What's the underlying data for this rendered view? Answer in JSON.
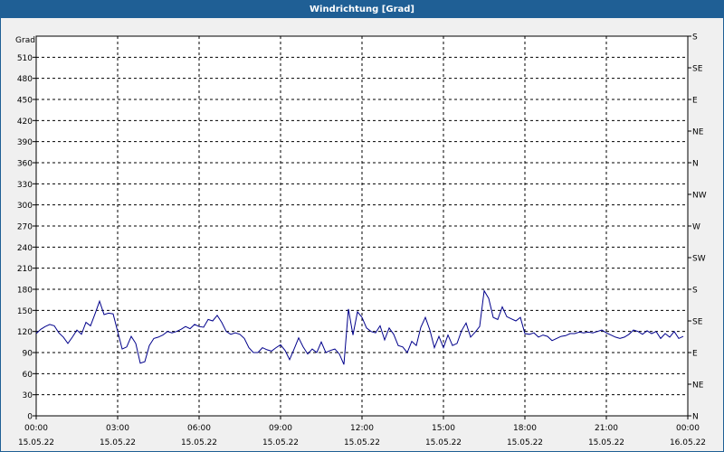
{
  "window": {
    "title": "Windrichtung [Grad]"
  },
  "chart_data": {
    "type": "line",
    "title": "Windrichtung [Grad]",
    "ylabel": "Grad",
    "ylim": [
      0,
      540
    ],
    "xlim": [
      "2022-05-15T00:00",
      "2022-05-16T00:00"
    ],
    "grid": true,
    "y_ticks": [
      0,
      30,
      60,
      90,
      120,
      150,
      180,
      210,
      240,
      270,
      300,
      330,
      360,
      390,
      420,
      450,
      480,
      510
    ],
    "y2_ticks": [
      {
        "value": 0,
        "label": "N"
      },
      {
        "value": 45,
        "label": "NE"
      },
      {
        "value": 90,
        "label": "E"
      },
      {
        "value": 135,
        "label": "SE"
      },
      {
        "value": 180,
        "label": "S"
      },
      {
        "value": 225,
        "label": "SW"
      },
      {
        "value": 270,
        "label": "W"
      },
      {
        "value": 315,
        "label": "NW"
      },
      {
        "value": 360,
        "label": "N"
      },
      {
        "value": 405,
        "label": "NE"
      },
      {
        "value": 450,
        "label": "E"
      },
      {
        "value": 495,
        "label": "SE"
      },
      {
        "value": 540,
        "label": "S"
      }
    ],
    "x_ticks": [
      {
        "time": "00:00",
        "date": "15.05.22"
      },
      {
        "time": "03:00",
        "date": "15.05.22"
      },
      {
        "time": "06:00",
        "date": "15.05.22"
      },
      {
        "time": "09:00",
        "date": "15.05.22"
      },
      {
        "time": "12:00",
        "date": "15.05.22"
      },
      {
        "time": "15:00",
        "date": "15.05.22"
      },
      {
        "time": "18:00",
        "date": "15.05.22"
      },
      {
        "time": "21:00",
        "date": "15.05.22"
      },
      {
        "time": "00:00",
        "date": "16.05.22"
      }
    ],
    "series": [
      {
        "color": "#00008b",
        "points": [
          [
            "00:00",
            117
          ],
          [
            "00:10",
            123
          ],
          [
            "00:20",
            127
          ],
          [
            "00:30",
            130
          ],
          [
            "00:40",
            128
          ],
          [
            "00:50",
            118
          ],
          [
            "01:00",
            112
          ],
          [
            "01:10",
            103
          ],
          [
            "01:20",
            112
          ],
          [
            "01:30",
            122
          ],
          [
            "01:40",
            116
          ],
          [
            "01:50",
            133
          ],
          [
            "02:00",
            128
          ],
          [
            "02:10",
            145
          ],
          [
            "02:20",
            163
          ],
          [
            "02:30",
            144
          ],
          [
            "02:40",
            146
          ],
          [
            "02:50",
            145
          ],
          [
            "03:00",
            120
          ],
          [
            "03:10",
            95
          ],
          [
            "03:20",
            98
          ],
          [
            "03:30",
            113
          ],
          [
            "03:40",
            103
          ],
          [
            "03:50",
            75
          ],
          [
            "04:00",
            77
          ],
          [
            "04:10",
            100
          ],
          [
            "04:20",
            110
          ],
          [
            "04:30",
            112
          ],
          [
            "04:40",
            115
          ],
          [
            "04:50",
            120
          ],
          [
            "05:00",
            118
          ],
          [
            "05:10",
            120
          ],
          [
            "05:20",
            123
          ],
          [
            "05:30",
            127
          ],
          [
            "05:40",
            124
          ],
          [
            "05:50",
            130
          ],
          [
            "06:00",
            127
          ],
          [
            "06:10",
            126
          ],
          [
            "06:20",
            137
          ],
          [
            "06:30",
            135
          ],
          [
            "06:40",
            143
          ],
          [
            "06:50",
            133
          ],
          [
            "07:00",
            120
          ],
          [
            "07:10",
            116
          ],
          [
            "07:20",
            118
          ],
          [
            "07:30",
            116
          ],
          [
            "07:40",
            110
          ],
          [
            "07:50",
            97
          ],
          [
            "08:00",
            90
          ],
          [
            "08:10",
            90
          ],
          [
            "08:20",
            97
          ],
          [
            "08:30",
            94
          ],
          [
            "08:40",
            92
          ],
          [
            "08:50",
            97
          ],
          [
            "09:00",
            101
          ],
          [
            "09:10",
            93
          ],
          [
            "09:20",
            80
          ],
          [
            "09:30",
            95
          ],
          [
            "09:40",
            111
          ],
          [
            "09:50",
            98
          ],
          [
            "10:00",
            88
          ],
          [
            "10:10",
            95
          ],
          [
            "10:20",
            90
          ],
          [
            "10:30",
            105
          ],
          [
            "10:40",
            90
          ],
          [
            "10:50",
            93
          ],
          [
            "11:00",
            95
          ],
          [
            "11:10",
            88
          ],
          [
            "11:20",
            73
          ],
          [
            "11:30",
            152
          ],
          [
            "11:40",
            115
          ],
          [
            "11:50",
            148
          ],
          [
            "12:00",
            140
          ],
          [
            "12:10",
            125
          ],
          [
            "12:20",
            120
          ],
          [
            "12:30",
            118
          ],
          [
            "12:40",
            128
          ],
          [
            "12:50",
            108
          ],
          [
            "13:00",
            125
          ],
          [
            "13:10",
            116
          ],
          [
            "13:20",
            100
          ],
          [
            "13:30",
            98
          ],
          [
            "13:40",
            90
          ],
          [
            "13:50",
            106
          ],
          [
            "14:00",
            100
          ],
          [
            "14:10",
            126
          ],
          [
            "14:20",
            140
          ],
          [
            "14:30",
            122
          ],
          [
            "14:40",
            97
          ],
          [
            "14:50",
            113
          ],
          [
            "15:00",
            97
          ],
          [
            "15:10",
            115
          ],
          [
            "15:20",
            100
          ],
          [
            "15:30",
            103
          ],
          [
            "15:40",
            121
          ],
          [
            "15:50",
            132
          ],
          [
            "16:00",
            112
          ],
          [
            "16:10",
            119
          ],
          [
            "16:20",
            127
          ],
          [
            "16:30",
            178
          ],
          [
            "16:40",
            167
          ],
          [
            "16:50",
            140
          ],
          [
            "17:00",
            137
          ],
          [
            "17:10",
            155
          ],
          [
            "17:20",
            141
          ],
          [
            "17:30",
            138
          ],
          [
            "17:40",
            135
          ],
          [
            "17:50",
            140
          ],
          [
            "18:00",
            117
          ],
          [
            "18:10",
            116
          ],
          [
            "18:20",
            118
          ],
          [
            "18:30",
            112
          ],
          [
            "18:40",
            115
          ],
          [
            "18:50",
            113
          ],
          [
            "19:00",
            107
          ],
          [
            "19:10",
            110
          ],
          [
            "19:20",
            113
          ],
          [
            "19:30",
            114
          ],
          [
            "19:40",
            117
          ],
          [
            "19:50",
            117
          ],
          [
            "20:00",
            119
          ],
          [
            "20:10",
            118
          ],
          [
            "20:20",
            119
          ],
          [
            "20:30",
            118
          ],
          [
            "20:40",
            120
          ],
          [
            "20:50",
            122
          ],
          [
            "21:00",
            118
          ],
          [
            "21:10",
            115
          ],
          [
            "21:20",
            112
          ],
          [
            "21:30",
            110
          ],
          [
            "21:40",
            112
          ],
          [
            "21:50",
            116
          ],
          [
            "22:00",
            122
          ],
          [
            "22:10",
            120
          ],
          [
            "22:20",
            116
          ],
          [
            "22:30",
            121
          ],
          [
            "22:40",
            117
          ],
          [
            "22:50",
            120
          ],
          [
            "23:00",
            110
          ],
          [
            "23:10",
            117
          ],
          [
            "23:20",
            112
          ],
          [
            "23:30",
            120
          ],
          [
            "23:40",
            110
          ],
          [
            "23:50",
            113
          ]
        ]
      }
    ]
  }
}
